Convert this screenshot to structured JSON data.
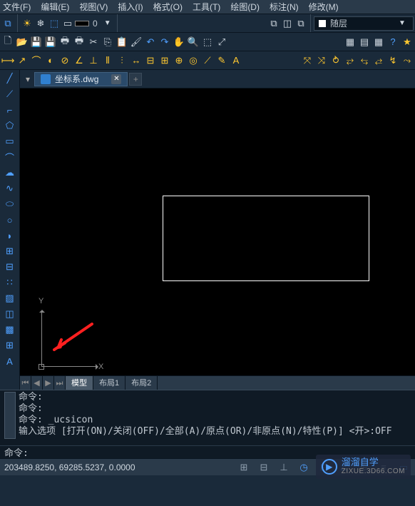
{
  "menu": {
    "file": "文件(F)",
    "edit": "编辑(E)",
    "view": "视图(V)",
    "insert": "插入(I)",
    "format": "格式(O)",
    "tools": "工具(T)",
    "draw": "绘图(D)",
    "annotate": "标注(N)",
    "modify": "修改(M)"
  },
  "toolbar1": {
    "lineweight_zero": "0"
  },
  "layer": {
    "label": "随层"
  },
  "tabbar": {
    "filename": "坐标系.dwg"
  },
  "ucs": {
    "x_label": "X",
    "y_label": "Y"
  },
  "layout_tabs": {
    "model": "模型",
    "layout1": "布局1",
    "layout2": "布局2"
  },
  "cmd": {
    "history": "命令:\n命令:\n命令: _ucsicon\n输入选项 [打开(ON)/关闭(OFF)/全部(A)/原点(OR)/非原点(N)/特性(P)] <开>:OFF",
    "prompt": "命令:",
    "input": ""
  },
  "status": {
    "coords": "203489.8250, 69285.5237, 0.0000"
  },
  "watermark": {
    "title": "溜溜自学",
    "url": "ZIXUE.3D66.COM"
  }
}
